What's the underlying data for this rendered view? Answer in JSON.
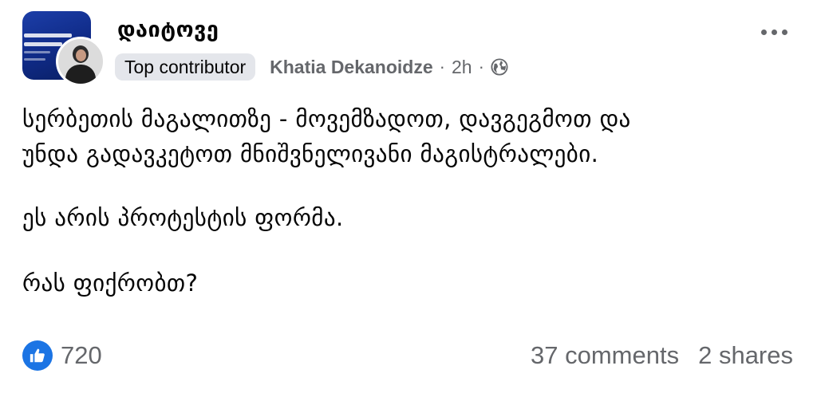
{
  "header": {
    "group_name": "დაიტოვე",
    "badge": "Top contributor",
    "author": "Khatia Dekanoidze",
    "separator": "·",
    "time": "2h",
    "privacy_icon": "globe-icon",
    "more_icon": "more-options-icon"
  },
  "post": {
    "lines": [
      "სერბეთის მაგალითზე - მოვემზადოთ, დავგეგმოთ და",
      "უნდა გადავკეტოთ მნიშვნელივანი მაგისტრალები.",
      "ეს არის პროტესტის ფორმა.",
      "რას ფიქრობთ?"
    ]
  },
  "footer": {
    "reaction_icon": "like-icon",
    "reaction_count": "720",
    "comments": "37 comments",
    "shares": "2 shares"
  },
  "colors": {
    "like_blue": "#1b74e4",
    "secondary_text": "#65676b",
    "badge_bg": "#e4e6eb",
    "group_avatar_blue": "#1c3ea8"
  }
}
